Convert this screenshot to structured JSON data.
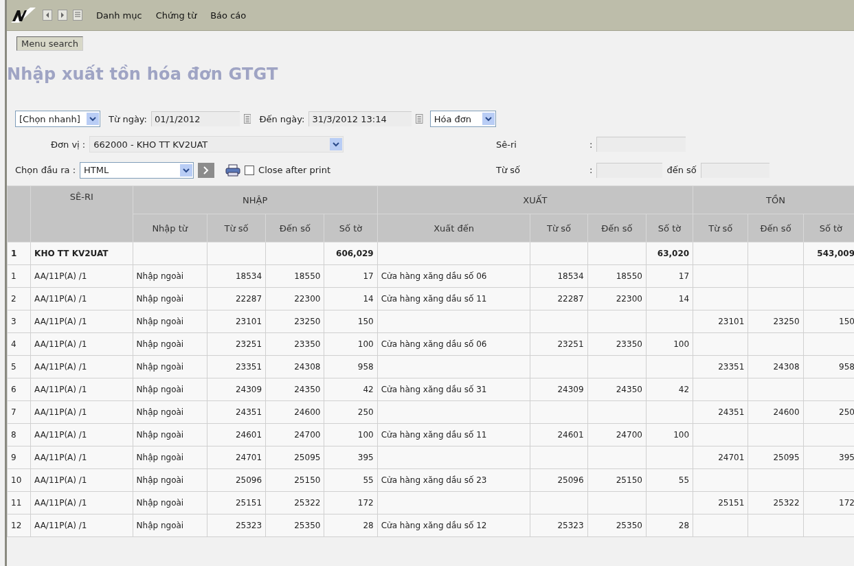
{
  "menu_bar": {
    "items": [
      "Danh mục",
      "Chứng từ",
      "Báo cáo"
    ]
  },
  "menu_search": "Menu search",
  "title": "Nhập xuất tồn hóa đơn GTGT",
  "filters": {
    "quick_select": "[Chọn nhanh]",
    "from_date_label": "Từ ngày:",
    "from_date": "01/1/2012",
    "to_date_label": "Đến ngày:",
    "to_date": "31/3/2012 13:14",
    "doc_type": "Hóa đơn",
    "unit_label": "Đơn vị :",
    "unit": "662000 - KHO TT KV2UAT",
    "series_label": "Sê-ri",
    "series_colon": ":",
    "output_label": "Chọn đầu ra :",
    "output": "HTML",
    "close_after_print": {
      "label": "Close after print",
      "checked": false
    },
    "from_no_label": "Từ số",
    "from_no_colon": ":",
    "to_no_label": "đến số"
  },
  "table": {
    "groups": [
      "SÊ-RI",
      "NHẬP",
      "XUẤT",
      "TỒN"
    ],
    "columns": [
      "Nhập từ",
      "Từ số",
      "Đến số",
      "Số tờ",
      "Xuất đến",
      "Từ số",
      "Đến số",
      "Số tờ",
      "Từ số",
      "Đến số",
      "Số tờ"
    ],
    "rows": [
      {
        "kind": "total",
        "no": "1",
        "series": "KHO TT KV2UAT",
        "import_sheets": "606,029",
        "export_sheets": "63,020",
        "stock_sheets": "543,009"
      },
      {
        "kind": "item",
        "no": "1",
        "series": "AA/11P(A) /1",
        "import_from": "Nhập ngoài",
        "import_from_no": "18534",
        "import_to_no": "18550",
        "import_sheets": "17",
        "export_to": "Cửa hàng xăng dầu số 06",
        "export_from_no": "18534",
        "export_to_no": "18550",
        "export_sheets": "17"
      },
      {
        "kind": "item",
        "no": "2",
        "series": "AA/11P(A) /1",
        "import_from": "Nhập ngoài",
        "import_from_no": "22287",
        "import_to_no": "22300",
        "import_sheets": "14",
        "export_to": "Cửa hàng xăng dầu số 11",
        "export_from_no": "22287",
        "export_to_no": "22300",
        "export_sheets": "14"
      },
      {
        "kind": "item",
        "no": "3",
        "series": "AA/11P(A) /1",
        "import_from": "Nhập ngoài",
        "import_from_no": "23101",
        "import_to_no": "23250",
        "import_sheets": "150",
        "stock_from_no": "23101",
        "stock_to_no": "23250",
        "stock_sheets": "150"
      },
      {
        "kind": "item",
        "no": "4",
        "series": "AA/11P(A) /1",
        "import_from": "Nhập ngoài",
        "import_from_no": "23251",
        "import_to_no": "23350",
        "import_sheets": "100",
        "export_to": "Cửa hàng xăng dầu số 06",
        "export_from_no": "23251",
        "export_to_no": "23350",
        "export_sheets": "100"
      },
      {
        "kind": "item",
        "no": "5",
        "series": "AA/11P(A) /1",
        "import_from": "Nhập ngoài",
        "import_from_no": "23351",
        "import_to_no": "24308",
        "import_sheets": "958",
        "stock_from_no": "23351",
        "stock_to_no": "24308",
        "stock_sheets": "958"
      },
      {
        "kind": "item",
        "no": "6",
        "series": "AA/11P(A) /1",
        "import_from": "Nhập ngoài",
        "import_from_no": "24309",
        "import_to_no": "24350",
        "import_sheets": "42",
        "export_to": "Cửa hàng xăng dầu số 31",
        "export_from_no": "24309",
        "export_to_no": "24350",
        "export_sheets": "42"
      },
      {
        "kind": "item",
        "no": "7",
        "series": "AA/11P(A) /1",
        "import_from": "Nhập ngoài",
        "import_from_no": "24351",
        "import_to_no": "24600",
        "import_sheets": "250",
        "stock_from_no": "24351",
        "stock_to_no": "24600",
        "stock_sheets": "250"
      },
      {
        "kind": "item",
        "no": "8",
        "series": "AA/11P(A) /1",
        "import_from": "Nhập ngoài",
        "import_from_no": "24601",
        "import_to_no": "24700",
        "import_sheets": "100",
        "export_to": "Cửa hàng xăng dầu số 11",
        "export_from_no": "24601",
        "export_to_no": "24700",
        "export_sheets": "100"
      },
      {
        "kind": "item",
        "no": "9",
        "series": "AA/11P(A) /1",
        "import_from": "Nhập ngoài",
        "import_from_no": "24701",
        "import_to_no": "25095",
        "import_sheets": "395",
        "stock_from_no": "24701",
        "stock_to_no": "25095",
        "stock_sheets": "395"
      },
      {
        "kind": "item",
        "no": "10",
        "series": "AA/11P(A) /1",
        "import_from": "Nhập ngoài",
        "import_from_no": "25096",
        "import_to_no": "25150",
        "import_sheets": "55",
        "export_to": "Cửa hàng xăng dầu số 23",
        "export_from_no": "25096",
        "export_to_no": "25150",
        "export_sheets": "55"
      },
      {
        "kind": "item",
        "no": "11",
        "series": "AA/11P(A) /1",
        "import_from": "Nhập ngoài",
        "import_from_no": "25151",
        "import_to_no": "25322",
        "import_sheets": "172",
        "stock_from_no": "25151",
        "stock_to_no": "25322",
        "stock_sheets": "172"
      },
      {
        "kind": "item",
        "no": "12",
        "series": "AA/11P(A) /1",
        "import_from": "Nhập ngoài",
        "import_from_no": "25323",
        "import_to_no": "25350",
        "import_sheets": "28",
        "export_to": "Cửa hàng xăng dầu số 12",
        "export_from_no": "25323",
        "export_to_no": "25350",
        "export_sheets": "28"
      }
    ]
  }
}
